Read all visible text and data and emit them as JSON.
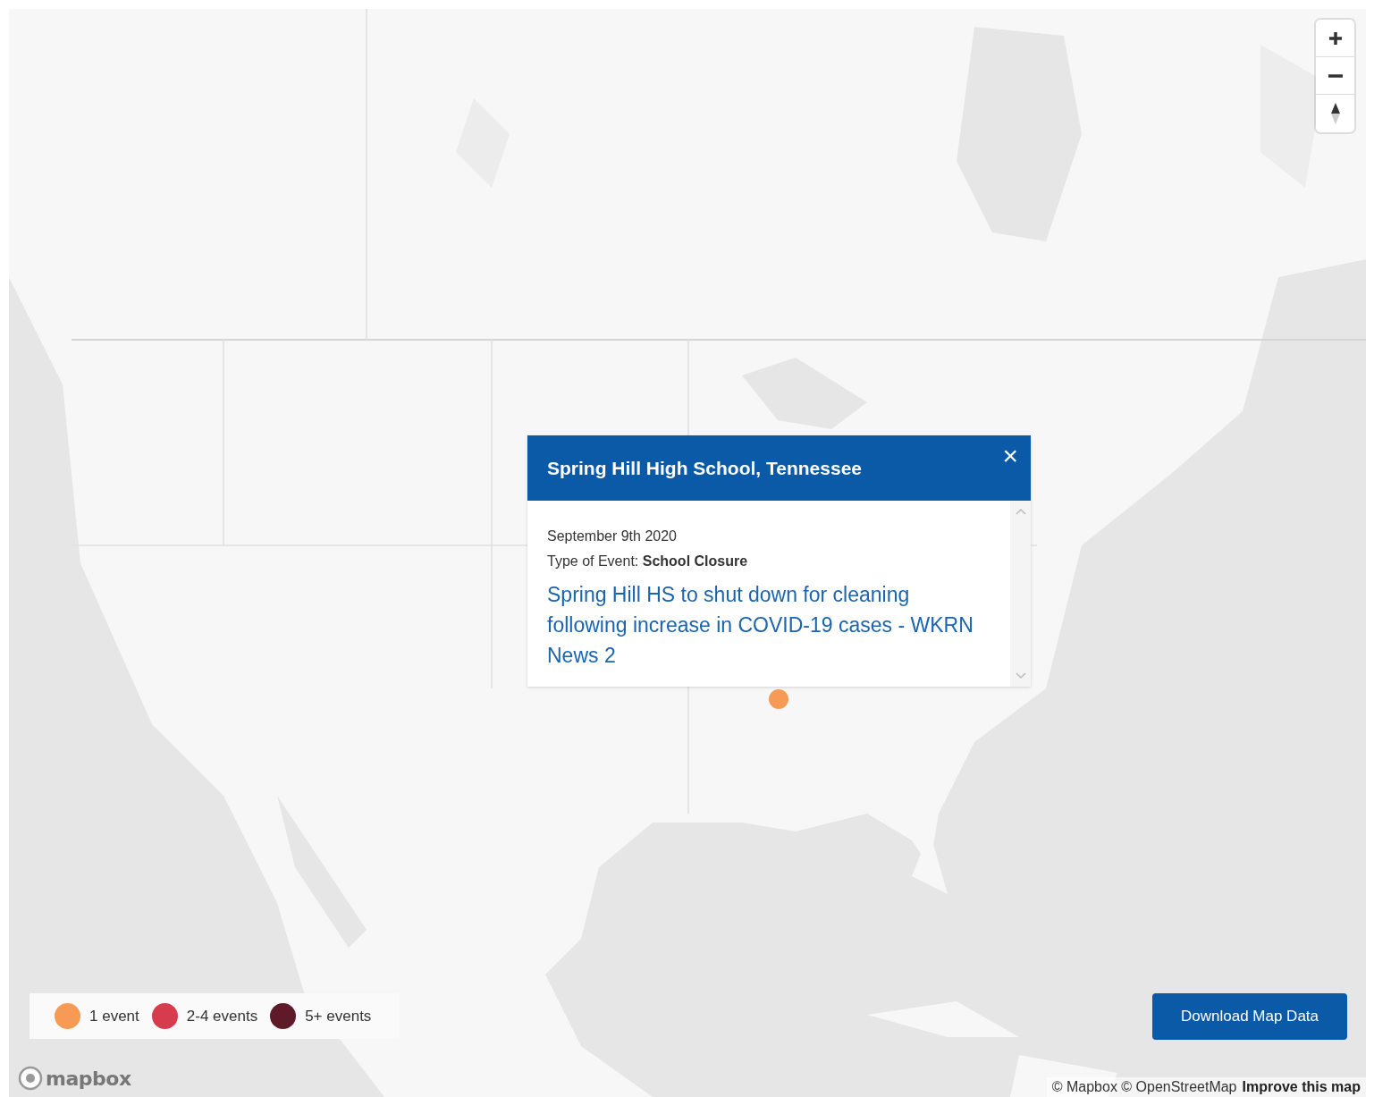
{
  "zoom_controls": [
    {
      "kind": "zoom_in"
    },
    {
      "kind": "zoom_out"
    },
    {
      "kind": "compass"
    }
  ],
  "markers": [
    {
      "color": "#f79a55"
    }
  ],
  "popup": {
    "title": "Spring Hill High School, Tennessee",
    "close": "×",
    "date": "September 9th 2020",
    "event_type_label": "Type of Event:",
    "event_type": "School Closure",
    "link": "Spring Hill HS to shut down for cleaning following increase in COVID-19 cases - WKRN News 2"
  },
  "legend": [
    {
      "label": "1 event",
      "color": "#f79a55"
    },
    {
      "label": "2-4 events",
      "color": "#d63c4e"
    },
    {
      "label": "5+ events",
      "color": "#5e1a28"
    }
  ],
  "download_button": "Download Map Data",
  "logo": "mapbox",
  "attribution": {
    "copyright": "© Mapbox © OpenStreetMap",
    "improve_link": "Improve this map"
  }
}
